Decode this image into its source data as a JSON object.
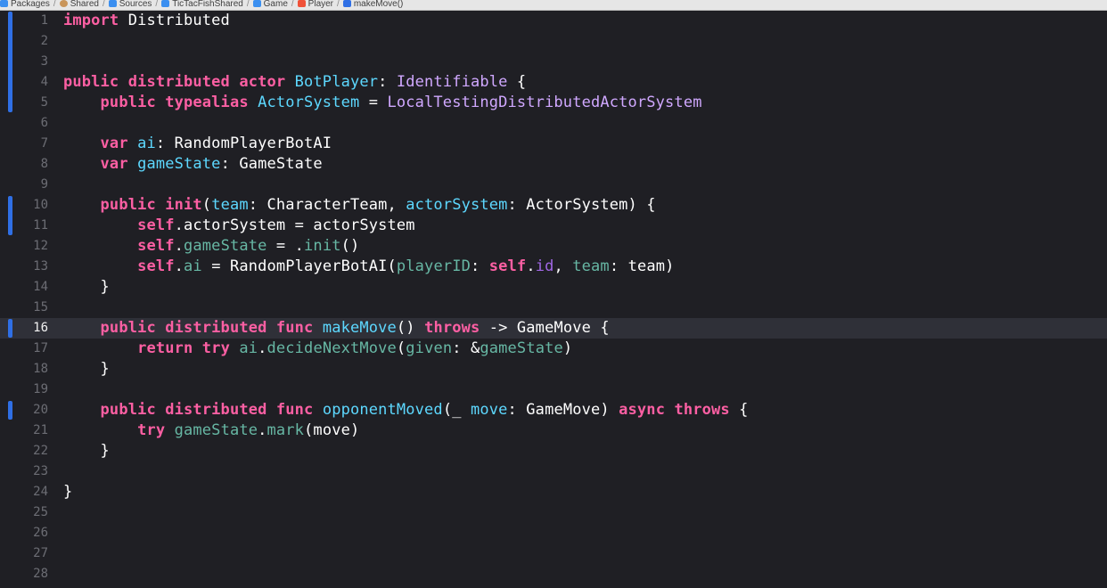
{
  "breadcrumb": [
    {
      "icon": "folder-icon",
      "label": "Packages"
    },
    {
      "icon": "package-icon",
      "label": "Shared"
    },
    {
      "icon": "folder-icon",
      "label": "Sources"
    },
    {
      "icon": "folder-icon",
      "label": "TicTacFishShared"
    },
    {
      "icon": "folder-icon",
      "label": "Game"
    },
    {
      "icon": "swift-file-icon",
      "label": "Player"
    },
    {
      "icon": "method-icon",
      "label": "makeMove()"
    }
  ],
  "editor": {
    "current_line": 16,
    "changed_lines": [
      1,
      2,
      3,
      4,
      5,
      10,
      11,
      16,
      20
    ],
    "lines": [
      {
        "n": "1",
        "tokens": [
          [
            "kw",
            "import"
          ],
          [
            "plain",
            " Distributed"
          ]
        ]
      },
      {
        "n": "2",
        "tokens": []
      },
      {
        "n": "3",
        "tokens": []
      },
      {
        "n": "4",
        "tokens": [
          [
            "kw",
            "public"
          ],
          [
            "plain",
            " "
          ],
          [
            "kw",
            "distributed"
          ],
          [
            "plain",
            " "
          ],
          [
            "kw",
            "actor"
          ],
          [
            "plain",
            " "
          ],
          [
            "decl",
            "BotPlayer"
          ],
          [
            "plain",
            ": "
          ],
          [
            "type",
            "Identifiable"
          ],
          [
            "plain",
            " {"
          ]
        ]
      },
      {
        "n": "5",
        "tokens": [
          [
            "plain",
            "    "
          ],
          [
            "kw",
            "public"
          ],
          [
            "plain",
            " "
          ],
          [
            "kw",
            "typealias"
          ],
          [
            "plain",
            " "
          ],
          [
            "decl",
            "ActorSystem"
          ],
          [
            "plain",
            " = "
          ],
          [
            "type",
            "LocalTestingDistributedActorSystem"
          ]
        ]
      },
      {
        "n": "6",
        "tokens": []
      },
      {
        "n": "7",
        "tokens": [
          [
            "plain",
            "    "
          ],
          [
            "kw",
            "var"
          ],
          [
            "plain",
            " "
          ],
          [
            "decl",
            "ai"
          ],
          [
            "plain",
            ": RandomPlayerBotAI"
          ]
        ]
      },
      {
        "n": "8",
        "tokens": [
          [
            "plain",
            "    "
          ],
          [
            "kw",
            "var"
          ],
          [
            "plain",
            " "
          ],
          [
            "decl",
            "gameState"
          ],
          [
            "plain",
            ": GameState"
          ]
        ]
      },
      {
        "n": "9",
        "tokens": []
      },
      {
        "n": "10",
        "tokens": [
          [
            "plain",
            "    "
          ],
          [
            "kw",
            "public"
          ],
          [
            "plain",
            " "
          ],
          [
            "kw",
            "init"
          ],
          [
            "plain",
            "("
          ],
          [
            "decl",
            "team"
          ],
          [
            "plain",
            ": CharacterTeam, "
          ],
          [
            "decl",
            "actorSystem"
          ],
          [
            "plain",
            ": ActorSystem) {"
          ]
        ]
      },
      {
        "n": "11",
        "tokens": [
          [
            "plain",
            "        "
          ],
          [
            "kw",
            "self"
          ],
          [
            "plain",
            ".actorSystem = actorSystem"
          ]
        ]
      },
      {
        "n": "12",
        "tokens": [
          [
            "plain",
            "        "
          ],
          [
            "kw",
            "self"
          ],
          [
            "plain",
            "."
          ],
          [
            "ident",
            "gameState"
          ],
          [
            "plain",
            " = ."
          ],
          [
            "ident",
            "init"
          ],
          [
            "plain",
            "()"
          ]
        ]
      },
      {
        "n": "13",
        "tokens": [
          [
            "plain",
            "        "
          ],
          [
            "kw",
            "self"
          ],
          [
            "plain",
            "."
          ],
          [
            "ident",
            "ai"
          ],
          [
            "plain",
            " = RandomPlayerBotAI("
          ],
          [
            "ident",
            "playerID"
          ],
          [
            "plain",
            ": "
          ],
          [
            "kw",
            "self"
          ],
          [
            "plain",
            "."
          ],
          [
            "proj",
            "id"
          ],
          [
            "plain",
            ", "
          ],
          [
            "ident",
            "team"
          ],
          [
            "plain",
            ": team)"
          ]
        ]
      },
      {
        "n": "14",
        "tokens": [
          [
            "plain",
            "    }"
          ]
        ]
      },
      {
        "n": "15",
        "tokens": []
      },
      {
        "n": "16",
        "tokens": [
          [
            "plain",
            "    "
          ],
          [
            "kw",
            "public"
          ],
          [
            "plain",
            " "
          ],
          [
            "kw",
            "distributed"
          ],
          [
            "plain",
            " "
          ],
          [
            "kw",
            "func"
          ],
          [
            "plain",
            " "
          ],
          [
            "decl",
            "makeMove"
          ],
          [
            "plain",
            "() "
          ],
          [
            "kw",
            "throws"
          ],
          [
            "plain",
            " -> GameMove {"
          ]
        ]
      },
      {
        "n": "17",
        "tokens": [
          [
            "plain",
            "        "
          ],
          [
            "kw",
            "return"
          ],
          [
            "plain",
            " "
          ],
          [
            "kw",
            "try"
          ],
          [
            "plain",
            " "
          ],
          [
            "ident",
            "ai"
          ],
          [
            "plain",
            "."
          ],
          [
            "ident",
            "decideNextMove"
          ],
          [
            "plain",
            "("
          ],
          [
            "ident",
            "given"
          ],
          [
            "plain",
            ": &"
          ],
          [
            "ident",
            "gameState"
          ],
          [
            "plain",
            ")"
          ]
        ]
      },
      {
        "n": "18",
        "tokens": [
          [
            "plain",
            "    }"
          ]
        ]
      },
      {
        "n": "19",
        "tokens": []
      },
      {
        "n": "20",
        "tokens": [
          [
            "plain",
            "    "
          ],
          [
            "kw",
            "public"
          ],
          [
            "plain",
            " "
          ],
          [
            "kw",
            "distributed"
          ],
          [
            "plain",
            " "
          ],
          [
            "kw",
            "func"
          ],
          [
            "plain",
            " "
          ],
          [
            "decl",
            "opponentMoved"
          ],
          [
            "plain",
            "(_ "
          ],
          [
            "decl",
            "move"
          ],
          [
            "plain",
            ": GameMove) "
          ],
          [
            "kw",
            "async"
          ],
          [
            "plain",
            " "
          ],
          [
            "kw",
            "throws"
          ],
          [
            "plain",
            " {"
          ]
        ]
      },
      {
        "n": "21",
        "tokens": [
          [
            "plain",
            "        "
          ],
          [
            "kw",
            "try"
          ],
          [
            "plain",
            " "
          ],
          [
            "ident",
            "gameState"
          ],
          [
            "plain",
            "."
          ],
          [
            "ident",
            "mark"
          ],
          [
            "plain",
            "(move)"
          ]
        ]
      },
      {
        "n": "22",
        "tokens": [
          [
            "plain",
            "    }"
          ]
        ]
      },
      {
        "n": "23",
        "tokens": []
      },
      {
        "n": "24",
        "tokens": [
          [
            "plain",
            "}"
          ]
        ]
      },
      {
        "n": "25",
        "tokens": []
      },
      {
        "n": "26",
        "tokens": []
      },
      {
        "n": "27",
        "tokens": []
      },
      {
        "n": "28",
        "tokens": []
      }
    ]
  }
}
